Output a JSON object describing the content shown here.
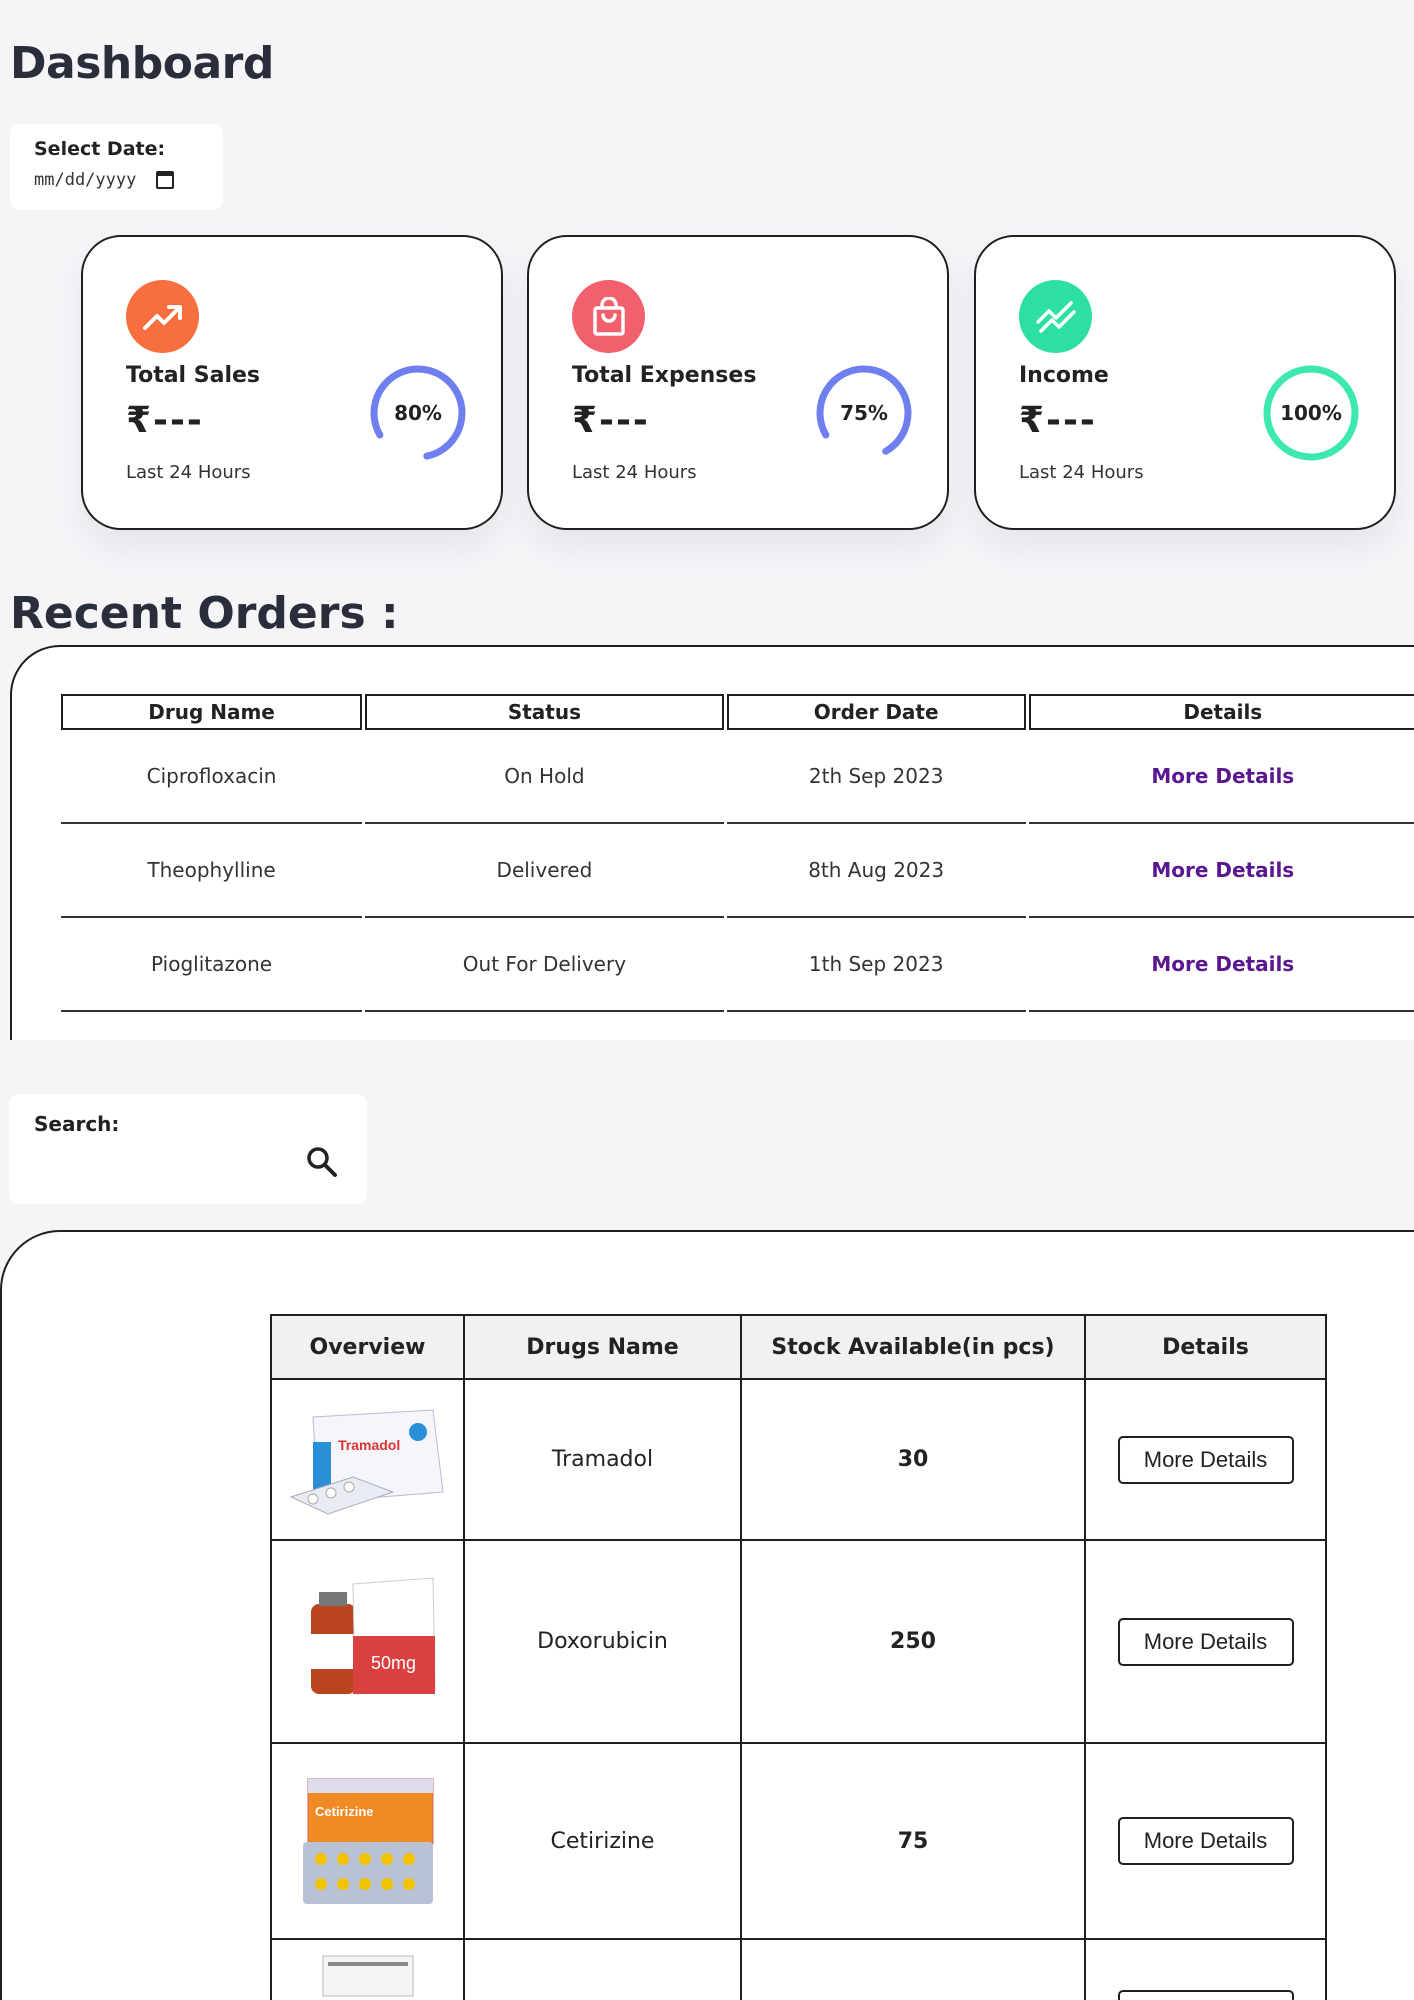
{
  "header": {
    "title": "Dashboard"
  },
  "date_filter": {
    "label": "Select Date:",
    "placeholder": "mm/dd/yyyy"
  },
  "cards": [
    {
      "label": "Total Sales",
      "amount": "₹---",
      "period": "Last 24 Hours",
      "percent_text": "80%",
      "percent": 80,
      "icon": "trending-up-icon",
      "icon_color": "#f86f3f",
      "ring_color": "#6f7ff0"
    },
    {
      "label": "Total Expenses",
      "amount": "₹---",
      "period": "Last 24 Hours",
      "percent_text": "75%",
      "percent": 75,
      "icon": "shopping-bag-icon",
      "icon_color": "#f2606d",
      "ring_color": "#6f7ff0"
    },
    {
      "label": "Income",
      "amount": "₹---",
      "period": "Last 24 Hours",
      "percent_text": "100%",
      "percent": 100,
      "icon": "chart-line-icon",
      "icon_color": "#2de0a2",
      "ring_color": "#3de8ae"
    }
  ],
  "recent_orders": {
    "title": "Recent Orders :",
    "headers": [
      "Drug Name",
      "Status",
      "Order Date",
      "Details"
    ],
    "rows": [
      {
        "drug": "Ciprofloxacin",
        "status": "On Hold",
        "date": "2th Sep 2023",
        "details": "More Details"
      },
      {
        "drug": "Theophylline",
        "status": "Delivered",
        "date": "8th Aug 2023",
        "details": "More Details"
      },
      {
        "drug": "Pioglitazone",
        "status": "Out For Delivery",
        "date": "1th Sep 2023",
        "details": "More Details"
      }
    ]
  },
  "search": {
    "label": "Search:"
  },
  "inventory": {
    "headers": [
      "Overview",
      "Drugs Name",
      "Stock Available(in pcs)",
      "Details"
    ],
    "rows": [
      {
        "name": "Tramadol",
        "stock": "30",
        "details": "More Details",
        "box_text": "Tramadol",
        "box_color": "#2a8fd6"
      },
      {
        "name": "Doxorubicin",
        "stock": "250",
        "details": "More Details",
        "box_text": "50mg",
        "box_color": "#d94040"
      },
      {
        "name": "Cetirizine",
        "stock": "75",
        "details": "More Details",
        "box_text": "Cetirizine",
        "box_color": "#f08a24"
      },
      {
        "name": "",
        "stock": "",
        "details": "",
        "box_text": "",
        "box_color": "#999999"
      }
    ]
  }
}
